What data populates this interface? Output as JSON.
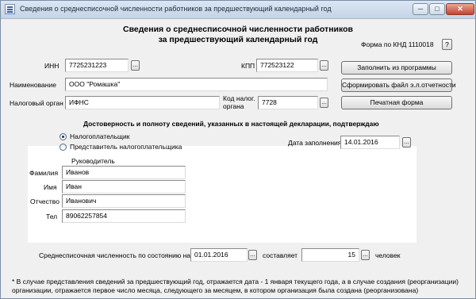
{
  "window": {
    "title": "Сведения о среднесписочной численности работников за предшествующий календарный год",
    "minimize_glyph": "─",
    "maximize_glyph": "□",
    "close_glyph": "✕"
  },
  "header": {
    "line1": "Сведения о среднесписочной численности работников",
    "line2": "за предшествующий календарный год",
    "form_code": "Форма по КНД 1110018",
    "help_label": "?"
  },
  "org": {
    "inn_label": "ИНН",
    "inn_value": "7725231223",
    "kpp_label": "КПП",
    "kpp_value": "772523122",
    "name_label": "Наименование",
    "name_value": "ООО \"Ромашка\"",
    "tax_office_label": "Налоговый орган",
    "tax_office_value": "ИФНС",
    "tax_code_label_line1": "Код налог.",
    "tax_code_label_line2": "органа",
    "tax_code_value": "7728",
    "ellipsis": "..."
  },
  "actions": {
    "fill_from_program": "Заполнить из программы",
    "generate_file": "Сформировать файл э.л.отчетности",
    "print_form": "Печатная форма"
  },
  "confirm": {
    "heading": "Достоверность и полноту сведений, указанных в настоящей декларации, подтверждаю",
    "option_taxpayer": "Налогоплательщик",
    "option_representative": "Представитель налогоплательщика",
    "selected": "taxpayer",
    "date_label": "Дата заполнения",
    "date_value": "14.01.2016"
  },
  "head_person": {
    "section_label": "Руководитель",
    "surname_label": "Фамилия",
    "surname_value": "Иванов",
    "name_label": "Имя",
    "name_value": "Иван",
    "patronymic_label": "Отчество",
    "patronymic_value": "Иванович",
    "phone_label": "Тел",
    "phone_value": "89062257854"
  },
  "headcount": {
    "label_prefix": "Среднесписочная численность по состоянию на",
    "date_value": "01.01.2016",
    "label_middle": "составляет",
    "count_value": "15",
    "label_suffix": "человек"
  },
  "footnote": "* В случае представления сведений за предшествующий год, отражается дата - 1 января текущего года, а в случае создания (реорганизации) организации, отражается первое число месяца, следующего за месяцем, в котором организация была создана (реорганизована)"
}
